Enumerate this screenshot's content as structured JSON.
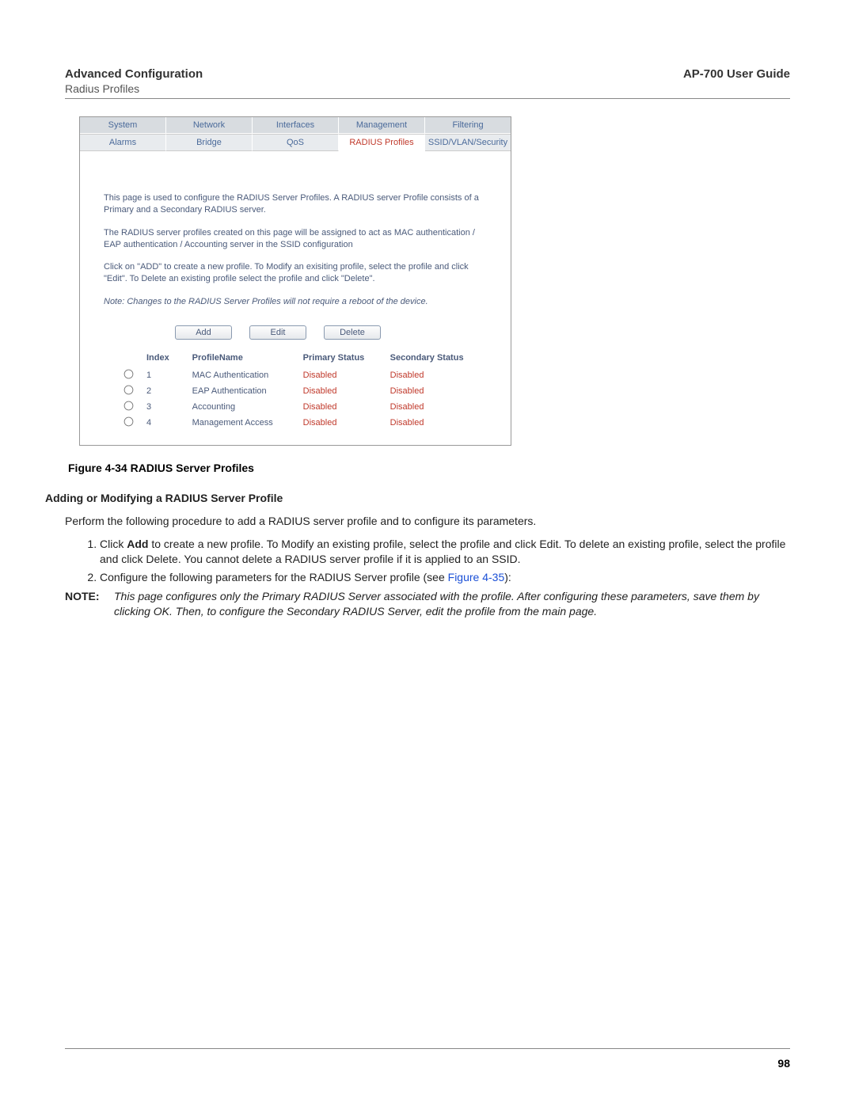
{
  "header": {
    "title": "Advanced Configuration",
    "subtitle": "Radius Profiles",
    "guide": "AP-700 User Guide"
  },
  "tabs_row1": [
    "System",
    "Network",
    "Interfaces",
    "Management",
    "Filtering"
  ],
  "tabs_row2": [
    "Alarms",
    "Bridge",
    "QoS",
    "RADIUS Profiles",
    "SSID/VLAN/Security"
  ],
  "active_tab2_index": 3,
  "panel": {
    "p1": "This page is used to configure the RADIUS Server Profiles. A RADIUS server Profile consists of a Primary and a Secondary RADIUS server.",
    "p2": "The RADIUS server profiles created on this page will be assigned to act as MAC authentication / EAP authentication / Accounting server in the SSID configuration",
    "p3": "Click on \"ADD\" to create a new profile. To Modify an exisiting profile, select the profile and click \"Edit\". To Delete an existing profile select the profile and click \"Delete\".",
    "note": "Note: Changes to the RADIUS Server Profiles will not require a reboot of the device."
  },
  "buttons": {
    "add": "Add",
    "edit": "Edit",
    "delete": "Delete"
  },
  "table": {
    "headers": [
      "Index",
      "ProfileName",
      "Primary Status",
      "Secondary Status"
    ],
    "rows": [
      {
        "index": "1",
        "name": "MAC Authentication",
        "primary": "Disabled",
        "secondary": "Disabled"
      },
      {
        "index": "2",
        "name": "EAP Authentication",
        "primary": "Disabled",
        "secondary": "Disabled"
      },
      {
        "index": "3",
        "name": "Accounting",
        "primary": "Disabled",
        "secondary": "Disabled"
      },
      {
        "index": "4",
        "name": "Management Access",
        "primary": "Disabled",
        "secondary": "Disabled"
      }
    ]
  },
  "figure_caption": "Figure 4-34 RADIUS Server Profiles",
  "section_heading": "Adding or Modifying a RADIUS Server Profile",
  "intro_text": "Perform the following procedure to add a RADIUS server profile and to configure its parameters.",
  "step1": {
    "prefix": "Click ",
    "bold": "Add",
    "rest": " to create a new profile. To Modify an existing profile, select the profile and click Edit. To delete an existing profile, select the profile and click Delete. You cannot delete a RADIUS server profile if it is applied to an SSID."
  },
  "step2": {
    "prefix": "Configure the following parameters for the RADIUS Server profile (see ",
    "link": "Figure 4-35",
    "suffix": "):"
  },
  "note_block": {
    "label": "NOTE:",
    "body": "This page configures only the Primary RADIUS Server associated with the profile. After configuring these parameters, save them by clicking OK. Then, to configure the Secondary RADIUS Server, edit the profile from the main page."
  },
  "page_number": "98"
}
